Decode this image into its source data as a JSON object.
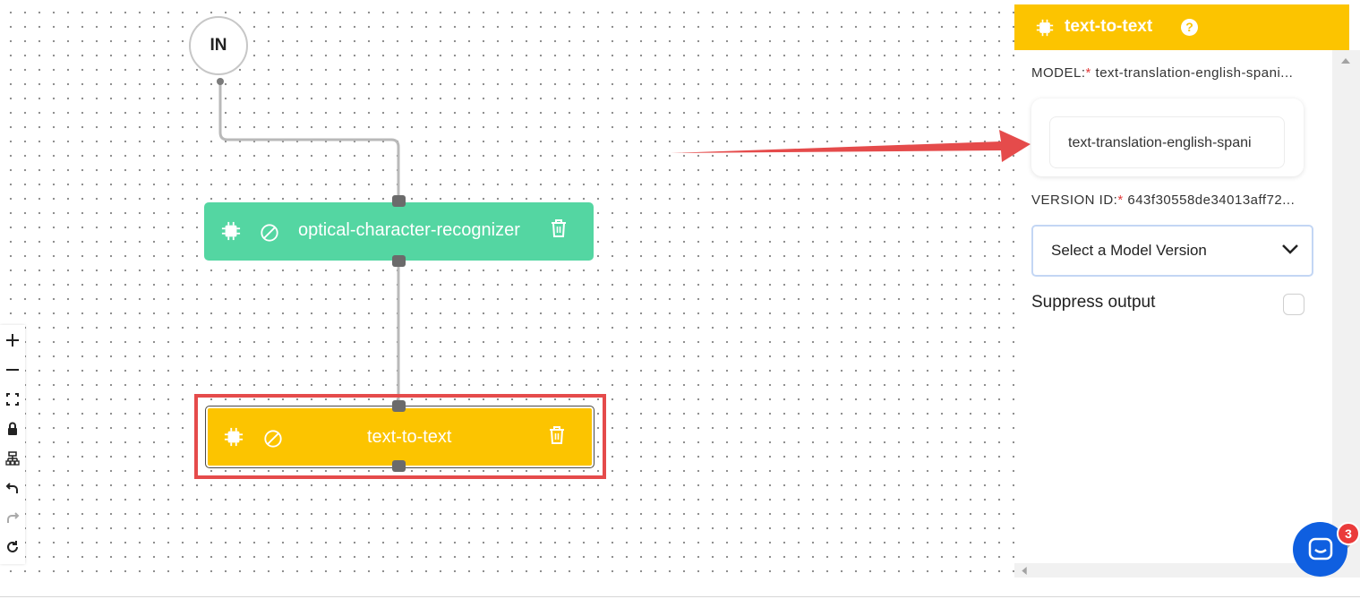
{
  "canvas": {
    "input_node_label": "IN",
    "nodes": [
      {
        "label": "optical-character-recognizer",
        "color": "#54d6a2"
      },
      {
        "label": "text-to-text",
        "color": "#fcc400"
      }
    ],
    "highlight_color": "#e54b4b",
    "controls": [
      "plus-icon",
      "minus-icon",
      "fit-view-icon",
      "lock-icon",
      "layout-icon",
      "undo-icon",
      "redo-icon",
      "refresh-icon"
    ]
  },
  "panel": {
    "title": "text-to-text",
    "help_icon": "?",
    "model_label": "MODEL:",
    "required_mark": "*",
    "model_value": "text-translation-english-spani...",
    "model_chip_text": "text-translation-english-spani",
    "version_label": "VERSION ID:",
    "version_value": "643f30558de34013aff72...",
    "select_placeholder": "Select a Model Version",
    "suppress_label": "Suppress output",
    "suppress_checked": false,
    "header_color": "#fcc400"
  },
  "chat_widget": {
    "badge_count": "3",
    "color": "#0f5fe0"
  }
}
